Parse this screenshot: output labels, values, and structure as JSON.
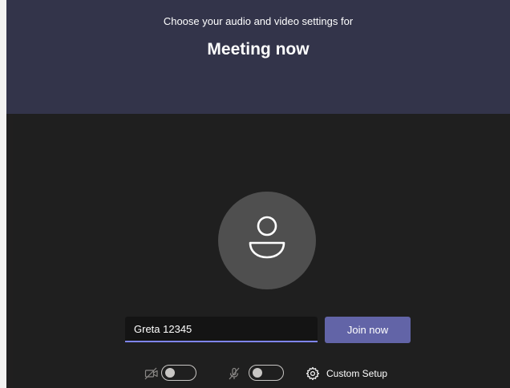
{
  "header": {
    "subtitle": "Choose your audio and video settings for",
    "title": "Meeting now"
  },
  "join_form": {
    "name_value": "Greta 12345",
    "join_label": "Join now"
  },
  "device_controls": {
    "camera_toggle_state": "off",
    "microphone_toggle_state": "off",
    "custom_setup_label": "Custom Setup"
  },
  "colors": {
    "header_bg": "#33344a",
    "preview_bg": "#1f1f1f",
    "avatar_bg": "#4f4f4f",
    "accent": "#6264a7",
    "input_underline": "#7f85f5"
  },
  "icons": {
    "avatar": "person-icon",
    "camera": "camera-off-icon",
    "microphone": "microphone-off-icon",
    "settings": "gear-icon"
  }
}
